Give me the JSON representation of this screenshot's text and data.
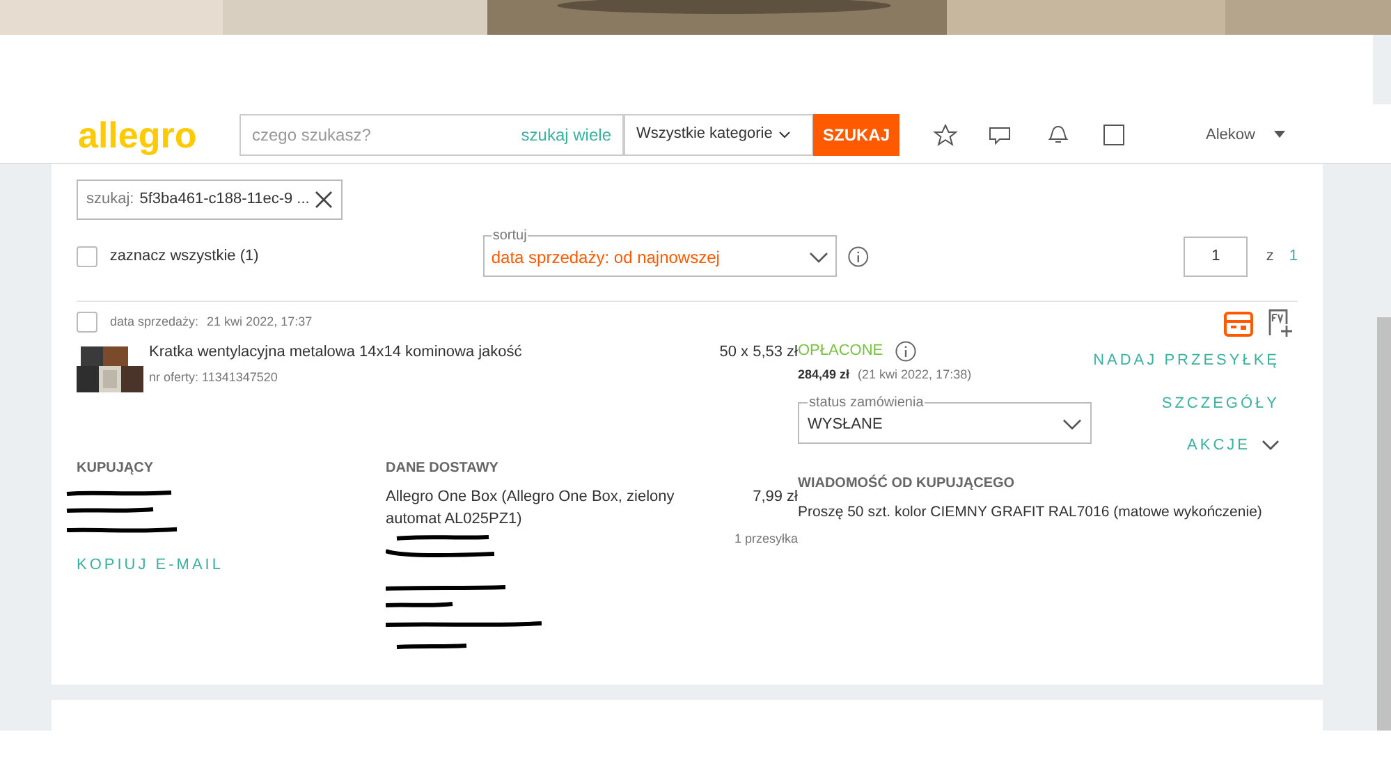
{
  "header": {
    "logo": "allegro",
    "search_placeholder": "czego szukasz?",
    "search_many": "szukaj wiele",
    "category": "Wszystkie kategorie",
    "search_button": "SZUKAJ",
    "user": "Alekow"
  },
  "filter": {
    "label": "szukaj:",
    "value": "5f3ba461-c188-11ec-9 ..."
  },
  "select_all": {
    "label": "zaznacz wszystkie (1)",
    "checked": false
  },
  "sort": {
    "label": "sortuj",
    "value": "data sprzedaży: od najnowszej"
  },
  "pagination": {
    "page": "1",
    "of": "z",
    "total": "1"
  },
  "order": {
    "checked": false,
    "sale_date_label": "data sprzedaży:",
    "sale_date": "21 kwi 2022, 17:37",
    "item": {
      "kind": "picture",
      "title": "Kratka wentylacyjna metalowa 14x14 kominowa jakość",
      "offer": "nr oferty: 11341347520",
      "quantity_price": "50 x 5,53 zł"
    },
    "payment": {
      "status": "OPŁACONE",
      "amount": "284,49 zł",
      "date": "(21 kwi 2022, 17:38)"
    },
    "order_status": {
      "label": "status zamówienia",
      "value": "WYSŁANE"
    },
    "actions": [
      {
        "label": "NADAJ PRZESYŁKĘ",
        "kind": "link"
      },
      {
        "label": "SZCZEGÓŁY",
        "kind": "link"
      },
      {
        "label": "AKCJE",
        "kind": "menu"
      }
    ],
    "buyer": {
      "heading": "KUPUJĄCY",
      "copy_email": "KOPIUJ E-MAIL"
    },
    "delivery": {
      "heading": "DANE DOSTAWY",
      "method": "Allegro One Box (Allegro One Box, zielony automat AL025PZ1)",
      "price": "7,99 zł",
      "packages": "1 przesyłka"
    },
    "message": {
      "heading": "WIADOMOŚĆ OD KUPUJĄCEGO",
      "text": "Proszę 50 szt. kolor CIEMNY GRAFIT RAL7016 (matowe wykończenie)"
    }
  }
}
